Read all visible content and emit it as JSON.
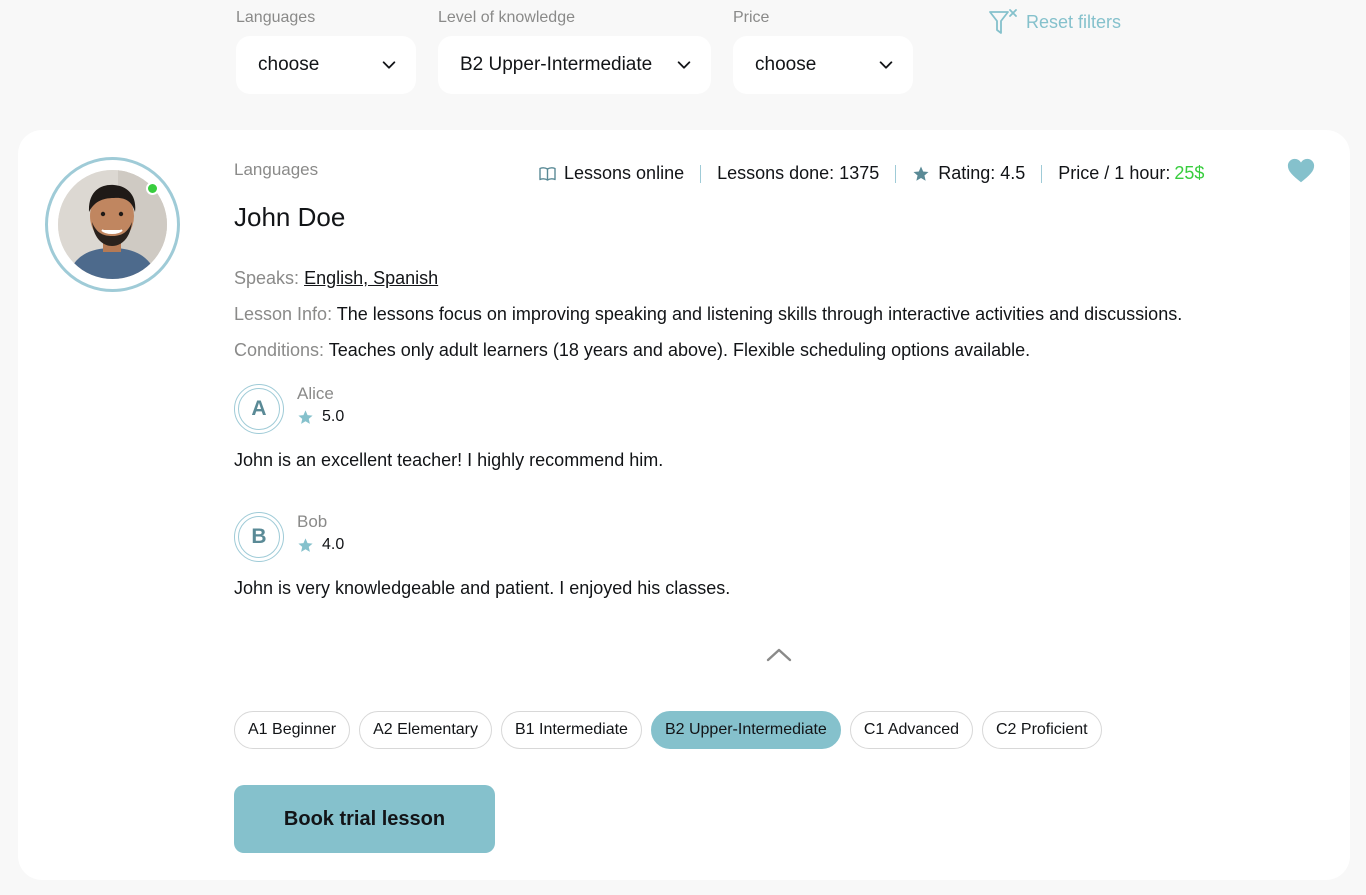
{
  "filters": {
    "languages": {
      "label": "Languages",
      "value": "choose"
    },
    "level": {
      "label": "Level of knowledge",
      "value": "B2 Upper-Intermediate"
    },
    "price": {
      "label": "Price",
      "value": "choose"
    },
    "reset_label": "Reset filters"
  },
  "teacher": {
    "eyebrow": "Languages",
    "name": "John Doe",
    "online": true,
    "stats": {
      "lessons_online": "Lessons online",
      "lessons_done": "Lessons done: 1375",
      "rating": "Rating: 4.5",
      "price_label": "Price / 1 hour:",
      "price_value": "25$"
    },
    "speaks_label": "Speaks:",
    "speaks_value": "English, Spanish",
    "lesson_info_label": "Lesson Info:",
    "lesson_info_value": "The lessons focus on improving speaking and listening skills through interactive activities and discussions.",
    "conditions_label": "Conditions:",
    "conditions_value": "Teaches only adult learners (18 years and above). Flexible scheduling options available."
  },
  "reviews": [
    {
      "initial": "A",
      "name": "Alice",
      "rating": "5.0",
      "text": "John is an excellent teacher! I highly recommend him."
    },
    {
      "initial": "B",
      "name": "Bob",
      "rating": "4.0",
      "text": "John is very knowledgeable and patient. I enjoyed his classes."
    }
  ],
  "levels": [
    {
      "label": "A1 Beginner",
      "active": false
    },
    {
      "label": "A2 Elementary",
      "active": false
    },
    {
      "label": "B1 Intermediate",
      "active": false
    },
    {
      "label": "B2 Upper-Intermediate",
      "active": true
    },
    {
      "label": "C1 Advanced",
      "active": false
    },
    {
      "label": "C2 Proficient",
      "active": false
    }
  ],
  "book_button": "Book trial lesson",
  "icons": {
    "filter_reset": "filter-x-icon",
    "chevron": "chevron-down-icon",
    "book": "book-open-icon",
    "star": "star-icon",
    "heart": "heart-icon",
    "collapse": "chevron-up-icon"
  },
  "colors": {
    "accent": "#85c1cc",
    "accent_border": "#9fcbd7",
    "price_green": "#38cd3e",
    "muted_text": "#8a8a89",
    "text": "#121417",
    "page_bg": "#f8f8f8"
  }
}
